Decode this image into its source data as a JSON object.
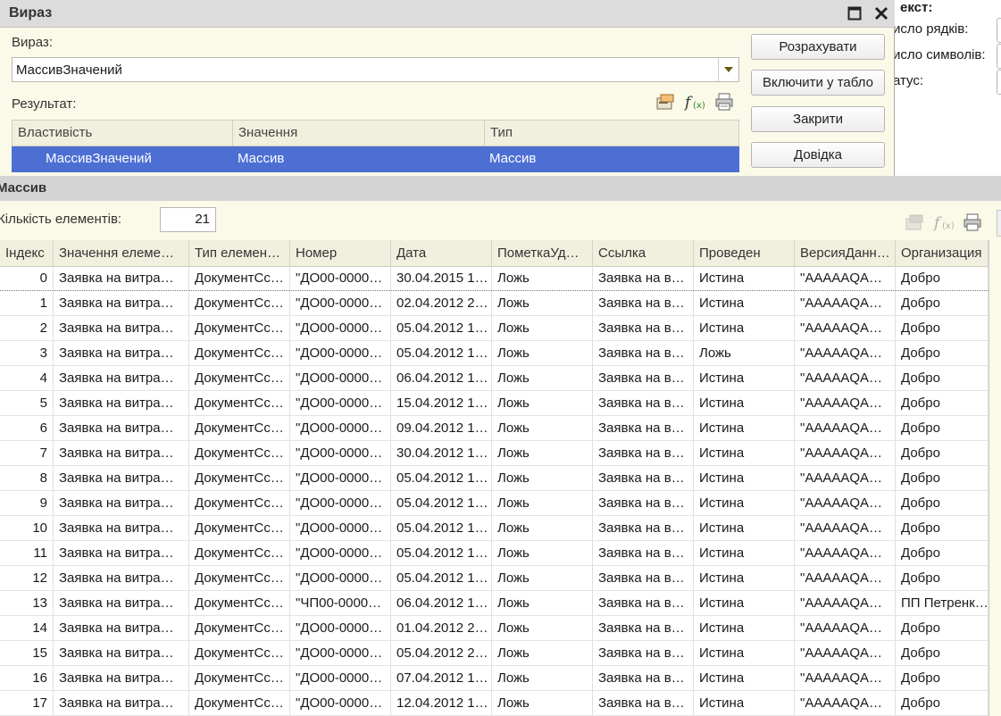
{
  "background_window": {
    "title": "екст:",
    "rows": [
      "исло рядків:",
      "исло символів:",
      "атус:"
    ]
  },
  "dialog": {
    "title": "Вираз",
    "expr_label": "Вираз:",
    "expr_value": "МассивЗначений",
    "result_label": "Результат:",
    "buttons": {
      "calculate": "Розрахувати",
      "include": "Включити у табло",
      "close": "Закрити",
      "help": "Довідка"
    },
    "result_table": {
      "columns": [
        "Властивість",
        "Значення",
        "Тип"
      ],
      "rows": [
        [
          "МассивЗначений",
          "Массив",
          "Массив"
        ]
      ]
    }
  },
  "array_window": {
    "title": "Массив",
    "count_label": "Кількість елементів:",
    "count_value": "21",
    "columns": [
      "Індекс",
      "Значення елеме…",
      "Тип елемен…",
      "Номер",
      "Дата",
      "ПометкаУд…",
      "Ссылка",
      "Проведен",
      "ВерсияДанн…",
      "Организация"
    ],
    "rows": [
      [
        "0",
        "Заявка на витра…",
        "ДокументСс…",
        "\"ДО00-0000…",
        "30.04.2015 1…",
        "Ложь",
        "Заявка на в…",
        "Истина",
        "\"AAAAAQA…",
        "Добро"
      ],
      [
        "1",
        "Заявка на витра…",
        "ДокументСс…",
        "\"ДО00-0000…",
        "02.04.2012 2…",
        "Ложь",
        "Заявка на в…",
        "Истина",
        "\"AAAAAQA…",
        "Добро"
      ],
      [
        "2",
        "Заявка на витра…",
        "ДокументСс…",
        "\"ДО00-0000…",
        "05.04.2012 1…",
        "Ложь",
        "Заявка на в…",
        "Истина",
        "\"AAAAAQA…",
        "Добро"
      ],
      [
        "3",
        "Заявка на витра…",
        "ДокументСс…",
        "\"ДО00-0000…",
        "05.04.2012 1…",
        "Ложь",
        "Заявка на в…",
        "Ложь",
        "\"AAAAAQA…",
        "Добро"
      ],
      [
        "4",
        "Заявка на витра…",
        "ДокументСс…",
        "\"ДО00-0000…",
        "06.04.2012 1…",
        "Ложь",
        "Заявка на в…",
        "Истина",
        "\"AAAAAQA…",
        "Добро"
      ],
      [
        "5",
        "Заявка на витра…",
        "ДокументСс…",
        "\"ДО00-0000…",
        "15.04.2012 1…",
        "Ложь",
        "Заявка на в…",
        "Истина",
        "\"AAAAAQA…",
        "Добро"
      ],
      [
        "6",
        "Заявка на витра…",
        "ДокументСс…",
        "\"ДО00-0000…",
        "09.04.2012 1…",
        "Ложь",
        "Заявка на в…",
        "Истина",
        "\"AAAAAQA…",
        "Добро"
      ],
      [
        "7",
        "Заявка на витра…",
        "ДокументСс…",
        "\"ДО00-0000…",
        "30.04.2012 1…",
        "Ложь",
        "Заявка на в…",
        "Истина",
        "\"AAAAAQA…",
        "Добро"
      ],
      [
        "8",
        "Заявка на витра…",
        "ДокументСс…",
        "\"ДО00-0000…",
        "05.04.2012 1…",
        "Ложь",
        "Заявка на в…",
        "Истина",
        "\"AAAAAQA…",
        "Добро"
      ],
      [
        "9",
        "Заявка на витра…",
        "ДокументСс…",
        "\"ДО00-0000…",
        "05.04.2012 1…",
        "Ложь",
        "Заявка на в…",
        "Истина",
        "\"AAAAAQA…",
        "Добро"
      ],
      [
        "10",
        "Заявка на витра…",
        "ДокументСс…",
        "\"ДО00-0000…",
        "05.04.2012 1…",
        "Ложь",
        "Заявка на в…",
        "Истина",
        "\"AAAAAQA…",
        "Добро"
      ],
      [
        "11",
        "Заявка на витра…",
        "ДокументСс…",
        "\"ДО00-0000…",
        "05.04.2012 1…",
        "Ложь",
        "Заявка на в…",
        "Истина",
        "\"AAAAAQA…",
        "Добро"
      ],
      [
        "12",
        "Заявка на витра…",
        "ДокументСс…",
        "\"ДО00-0000…",
        "05.04.2012 1…",
        "Ложь",
        "Заявка на в…",
        "Истина",
        "\"AAAAAQA…",
        "Добро"
      ],
      [
        "13",
        "Заявка на витра…",
        "ДокументСс…",
        "\"ЧП00-0000…",
        "06.04.2012 1…",
        "Ложь",
        "Заявка на в…",
        "Истина",
        "\"AAAAAQA…",
        "ПП Петренк…"
      ],
      [
        "14",
        "Заявка на витра…",
        "ДокументСс…",
        "\"ДО00-0000…",
        "01.04.2012 2…",
        "Ложь",
        "Заявка на в…",
        "Истина",
        "\"AAAAAQA…",
        "Добро"
      ],
      [
        "15",
        "Заявка на витра…",
        "ДокументСс…",
        "\"ДО00-0000…",
        "05.04.2012 2…",
        "Ложь",
        "Заявка на в…",
        "Истина",
        "\"AAAAAQA…",
        "Добро"
      ],
      [
        "16",
        "Заявка на витра…",
        "ДокументСс…",
        "\"ДО00-0000…",
        "07.04.2012 1…",
        "Ложь",
        "Заявка на в…",
        "Истина",
        "\"AAAAAQA…",
        "Добро"
      ],
      [
        "17",
        "Заявка на витра…",
        "ДокументСс…",
        "\"ДО00-0000…",
        "12.04.2012 1…",
        "Ложь",
        "Заявка на в…",
        "Истина",
        "\"AAAAAQA…",
        "Добро"
      ]
    ]
  },
  "colors": {
    "selection": "#4d6ed3",
    "form_bg": "#fbf9e8",
    "header_bg": "#f1efde",
    "titlebar": "#dcdcdc"
  }
}
